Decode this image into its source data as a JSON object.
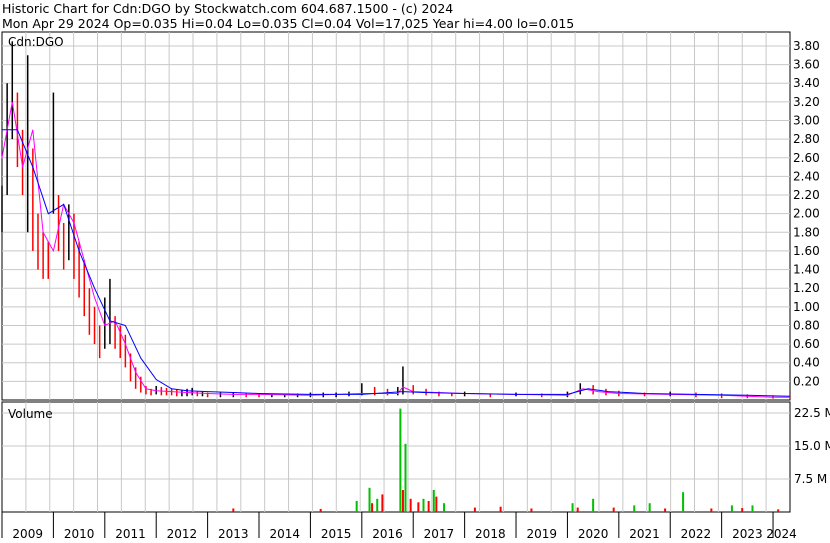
{
  "header": {
    "line1": "Historic Chart for Cdn:DGO by Stockwatch.com 604.687.1500 - (c) 2024",
    "line2": "Mon Apr 29 2024   Op=0.035  Hi=0.04  Lo=0.035  Cl=0.04  Vol=17,025  Year hi=4.00  lo=0.015"
  },
  "colors": {
    "background": "#ffffff",
    "grid": "#c8c8c8",
    "price_bar": "#000000",
    "price_bar_down": "#ff0000",
    "ma_short": "#ff00ff",
    "ma_long": "#0000ff",
    "vol_up": "#00c000",
    "vol_down": "#ff0000"
  },
  "chart_data": [
    {
      "type": "line",
      "panel": "price",
      "title": "Cdn:DGO",
      "y_ticks": [
        "0.20",
        "0.40",
        "0.60",
        "0.80",
        "1.00",
        "1.20",
        "1.40",
        "1.60",
        "1.80",
        "2.00",
        "2.20",
        "2.40",
        "2.60",
        "2.80",
        "3.00",
        "3.20",
        "3.40",
        "3.60",
        "3.80"
      ],
      "ylim": [
        0,
        3.95
      ],
      "x_ticks": [
        "2009",
        "2010",
        "2011",
        "2012",
        "2013",
        "2014",
        "2015",
        "2016",
        "2017",
        "2018",
        "2019",
        "2020",
        "2021",
        "2022",
        "2023",
        "2024"
      ],
      "xlim": [
        2009.0,
        2024.33
      ],
      "grid": true,
      "series": [
        {
          "kind": "high-low",
          "x": [
            2009.0,
            2009.1,
            2009.2,
            2009.3,
            2009.4,
            2009.5,
            2009.6,
            2009.7,
            2009.8,
            2009.9,
            2010.0,
            2010.1,
            2010.2,
            2010.3,
            2010.4,
            2010.5,
            2010.6,
            2010.7,
            2010.8,
            2010.9,
            2011.0,
            2011.1,
            2011.2,
            2011.3,
            2011.4,
            2011.5,
            2011.6,
            2011.7,
            2011.8,
            2011.9,
            2012.0,
            2012.1,
            2012.2,
            2012.3,
            2012.4,
            2012.5,
            2012.6,
            2012.7,
            2012.8,
            2012.9,
            2013.0,
            2013.25,
            2013.5,
            2013.75,
            2014.0,
            2014.25,
            2014.5,
            2014.75,
            2015.0,
            2015.25,
            2015.5,
            2015.75,
            2016.0,
            2016.25,
            2016.5,
            2016.7,
            2016.8,
            2017.0,
            2017.25,
            2017.5,
            2017.75,
            2018.0,
            2018.5,
            2019.0,
            2019.5,
            2020.0,
            2020.25,
            2020.5,
            2020.75,
            2021.0,
            2021.5,
            2022.0,
            2022.5,
            2023.0,
            2023.5,
            2024.0,
            2024.33
          ],
          "high": [
            2.3,
            3.4,
            3.85,
            3.3,
            2.9,
            3.7,
            2.7,
            2.0,
            1.8,
            1.7,
            3.3,
            2.2,
            1.9,
            2.1,
            2.0,
            1.7,
            1.5,
            1.2,
            1.0,
            0.8,
            1.1,
            1.3,
            0.9,
            0.8,
            0.7,
            0.5,
            0.35,
            0.25,
            0.15,
            0.12,
            0.15,
            0.14,
            0.13,
            0.12,
            0.11,
            0.11,
            0.12,
            0.13,
            0.09,
            0.09,
            0.08,
            0.08,
            0.08,
            0.07,
            0.06,
            0.06,
            0.06,
            0.07,
            0.08,
            0.08,
            0.08,
            0.09,
            0.18,
            0.14,
            0.12,
            0.14,
            0.36,
            0.16,
            0.12,
            0.09,
            0.08,
            0.09,
            0.07,
            0.08,
            0.07,
            0.09,
            0.18,
            0.16,
            0.12,
            0.1,
            0.08,
            0.09,
            0.08,
            0.07,
            0.06,
            0.05,
            0.04
          ],
          "low": [
            1.8,
            2.2,
            2.8,
            2.5,
            2.2,
            1.8,
            1.6,
            1.4,
            1.3,
            1.3,
            2.0,
            1.6,
            1.4,
            1.5,
            1.3,
            1.1,
            0.9,
            0.7,
            0.6,
            0.45,
            0.55,
            0.6,
            0.55,
            0.45,
            0.35,
            0.2,
            0.12,
            0.08,
            0.06,
            0.05,
            0.06,
            0.05,
            0.05,
            0.05,
            0.04,
            0.04,
            0.04,
            0.05,
            0.04,
            0.04,
            0.03,
            0.03,
            0.03,
            0.03,
            0.03,
            0.03,
            0.03,
            0.03,
            0.03,
            0.03,
            0.03,
            0.04,
            0.05,
            0.05,
            0.05,
            0.05,
            0.06,
            0.06,
            0.05,
            0.04,
            0.04,
            0.04,
            0.03,
            0.04,
            0.03,
            0.03,
            0.06,
            0.06,
            0.05,
            0.04,
            0.04,
            0.04,
            0.03,
            0.02,
            0.02,
            0.015,
            0.02
          ]
        },
        {
          "kind": "ma-short",
          "x": [
            2009.0,
            2009.2,
            2009.4,
            2009.6,
            2009.8,
            2010.0,
            2010.2,
            2010.4,
            2010.6,
            2010.8,
            2011.0,
            2011.2,
            2011.4,
            2011.6,
            2011.8,
            2012.0,
            2012.3,
            2012.6,
            2013.0,
            2013.5,
            2014.0,
            2015.0,
            2016.0,
            2016.7,
            2016.8,
            2017.0,
            2018.0,
            2019.0,
            2020.0,
            2020.3,
            2020.6,
            2021.0,
            2022.0,
            2023.0,
            2024.0,
            2024.33
          ],
          "y": [
            2.6,
            3.2,
            2.5,
            2.9,
            1.8,
            1.6,
            2.1,
            1.9,
            1.5,
            1.1,
            0.8,
            0.85,
            0.6,
            0.3,
            0.12,
            0.1,
            0.09,
            0.08,
            0.07,
            0.06,
            0.06,
            0.05,
            0.07,
            0.07,
            0.14,
            0.09,
            0.07,
            0.06,
            0.05,
            0.12,
            0.09,
            0.07,
            0.06,
            0.05,
            0.03,
            0.03
          ]
        },
        {
          "kind": "ma-long",
          "x": [
            2009.0,
            2009.3,
            2009.6,
            2009.9,
            2010.2,
            2010.5,
            2010.8,
            2011.1,
            2011.4,
            2011.7,
            2012.0,
            2012.3,
            2012.6,
            2013.0,
            2013.5,
            2014.0,
            2015.0,
            2016.0,
            2016.8,
            2017.2,
            2018.0,
            2019.0,
            2020.0,
            2020.4,
            2020.8,
            2021.5,
            2022.5,
            2023.5,
            2024.33
          ],
          "y": [
            2.9,
            2.9,
            2.5,
            2.0,
            2.1,
            1.6,
            1.2,
            0.85,
            0.8,
            0.45,
            0.22,
            0.12,
            0.1,
            0.09,
            0.08,
            0.07,
            0.06,
            0.06,
            0.09,
            0.08,
            0.07,
            0.06,
            0.06,
            0.12,
            0.09,
            0.07,
            0.06,
            0.05,
            0.04
          ]
        }
      ]
    },
    {
      "type": "bar",
      "panel": "volume",
      "title": "Volume",
      "y_ticks": [
        "7.5 M",
        "15.0 M",
        "22.5 M"
      ],
      "ylim": [
        0,
        25
      ],
      "x_ticks": [
        "2009",
        "2010",
        "2011",
        "2012",
        "2013",
        "2014",
        "2015",
        "2016",
        "2017",
        "2018",
        "2019",
        "2020",
        "2021",
        "2022",
        "2023",
        "2024"
      ],
      "xlim": [
        2009.0,
        2024.33
      ],
      "grid": true,
      "series": [
        {
          "name": "up",
          "x": [
            2015.9,
            2016.15,
            2016.3,
            2016.75,
            2016.85,
            2017.2,
            2017.4,
            2017.6,
            2020.1,
            2020.5,
            2021.3,
            2021.6,
            2022.25,
            2023.2,
            2023.6
          ],
          "values": [
            2.5,
            5.5,
            3.0,
            23.5,
            15.5,
            3.0,
            5.0,
            2.0,
            2.0,
            3.0,
            1.5,
            2.0,
            4.5,
            1.5,
            1.5
          ]
        },
        {
          "name": "down",
          "x": [
            2013.5,
            2015.2,
            2016.2,
            2016.4,
            2016.8,
            2016.95,
            2017.1,
            2017.3,
            2017.45,
            2018.2,
            2018.7,
            2019.3,
            2020.2,
            2020.9,
            2021.9,
            2022.8,
            2023.4,
            2024.1
          ],
          "values": [
            0.8,
            0.7,
            2.0,
            4.0,
            5.0,
            3.0,
            2.2,
            2.5,
            3.5,
            1.0,
            1.2,
            0.8,
            1.0,
            1.0,
            0.8,
            0.8,
            0.9,
            0.6
          ]
        }
      ]
    }
  ]
}
